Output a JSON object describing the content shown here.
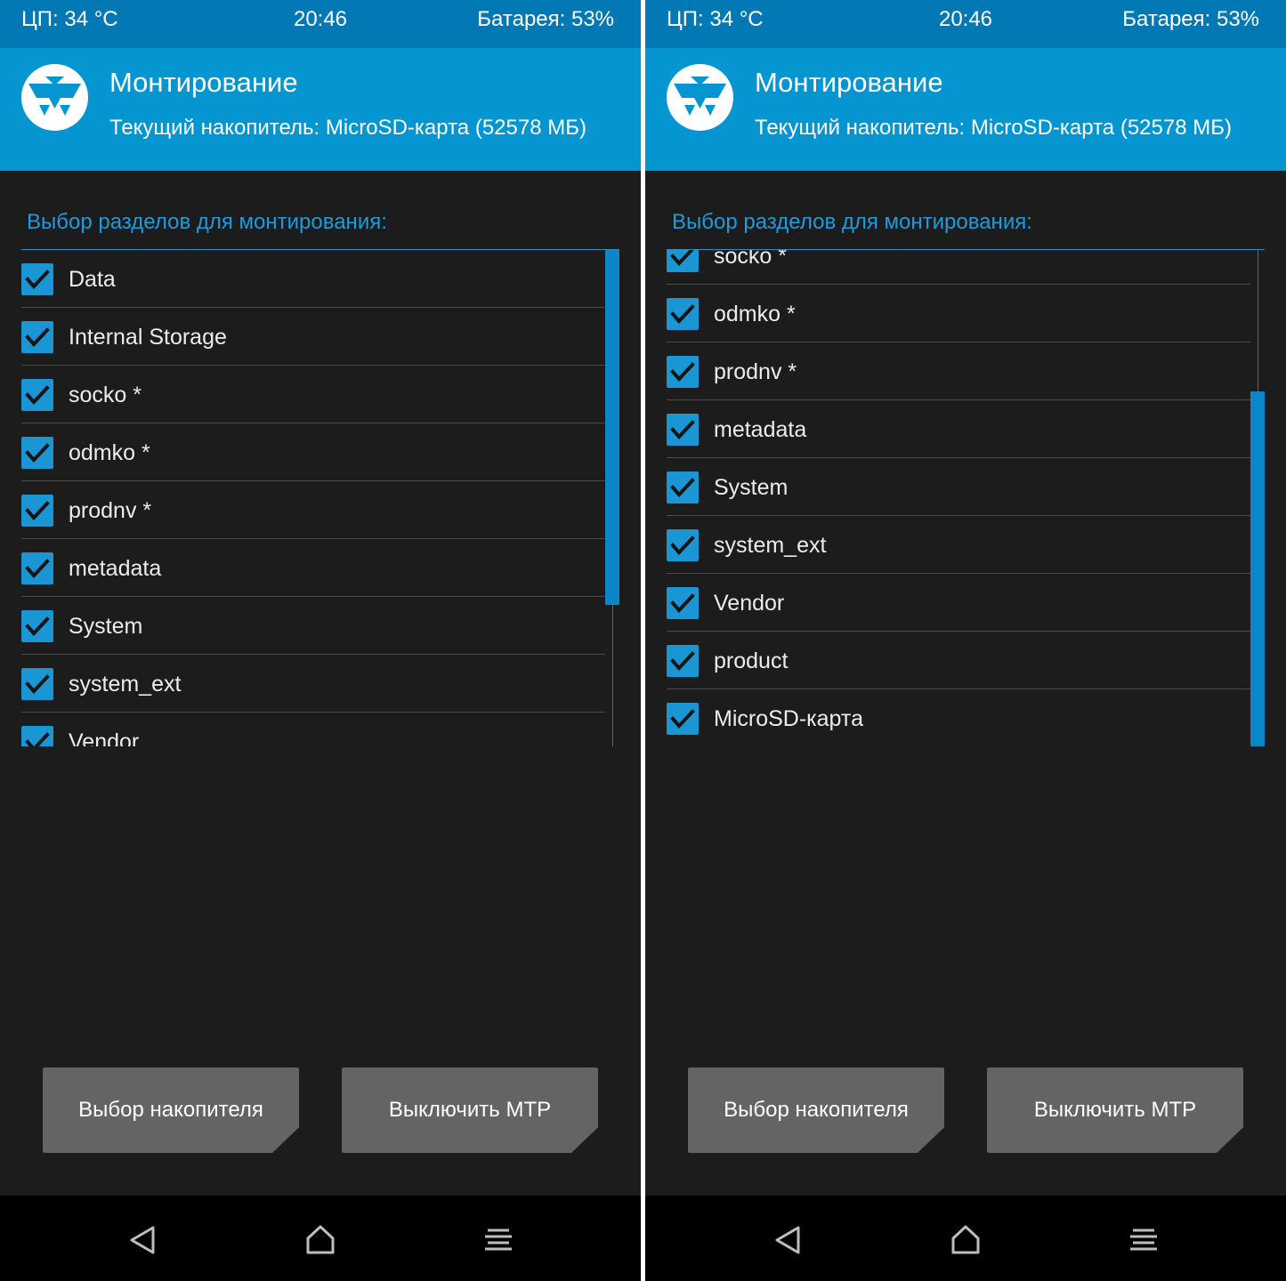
{
  "colors": {
    "status_bar": "#0278b5",
    "header": "#0595d0",
    "background": "#1c1c1c",
    "accent": "#1a96d4",
    "button": "#646464",
    "nav_bar": "#000000"
  },
  "icons": {
    "logo": "twrp-logo-icon",
    "checkbox": "checkmark-icon",
    "back": "back-triangle-icon",
    "home": "home-icon",
    "menu": "menu-lines-icon"
  },
  "screens": [
    {
      "status": {
        "cpu": "ЦП: 34 °C",
        "time": "20:46",
        "battery": "Батарея: 53%"
      },
      "header": {
        "title": "Монтирование",
        "subtitle": "Текущий накопитель: MicroSD-карта (52578 МБ)"
      },
      "section_label": "Выбор разделов для монтирования:",
      "partitions": [
        {
          "label": "Data",
          "checked": true
        },
        {
          "label": "Internal Storage",
          "checked": true
        },
        {
          "label": "socko *",
          "checked": true
        },
        {
          "label": "odmko *",
          "checked": true
        },
        {
          "label": "prodnv *",
          "checked": true
        },
        {
          "label": "metadata",
          "checked": true
        },
        {
          "label": "System",
          "checked": true
        },
        {
          "label": "system_ext",
          "checked": true
        },
        {
          "label": "Vendor",
          "checked": true
        }
      ],
      "scroll_position": 0.0,
      "buttons": {
        "select_storage": "Выбор накопителя",
        "disable_mtp": "Выключить MTP"
      }
    },
    {
      "status": {
        "cpu": "ЦП: 34 °C",
        "time": "20:46",
        "battery": "Батарея: 53%"
      },
      "header": {
        "title": "Монтирование",
        "subtitle": "Текущий накопитель: MicroSD-карта (52578 МБ)"
      },
      "section_label": "Выбор разделов для монтирования:",
      "partitions": [
        {
          "label": "socko *",
          "checked": true
        },
        {
          "label": "odmko *",
          "checked": true
        },
        {
          "label": "prodnv *",
          "checked": true
        },
        {
          "label": "metadata",
          "checked": true
        },
        {
          "label": "System",
          "checked": true
        },
        {
          "label": "system_ext",
          "checked": true
        },
        {
          "label": "Vendor",
          "checked": true
        },
        {
          "label": "product",
          "checked": true
        },
        {
          "label": "MicroSD-карта",
          "checked": true
        }
      ],
      "scroll_position": 1.0,
      "buttons": {
        "select_storage": "Выбор накопителя",
        "disable_mtp": "Выключить MTP"
      }
    }
  ]
}
